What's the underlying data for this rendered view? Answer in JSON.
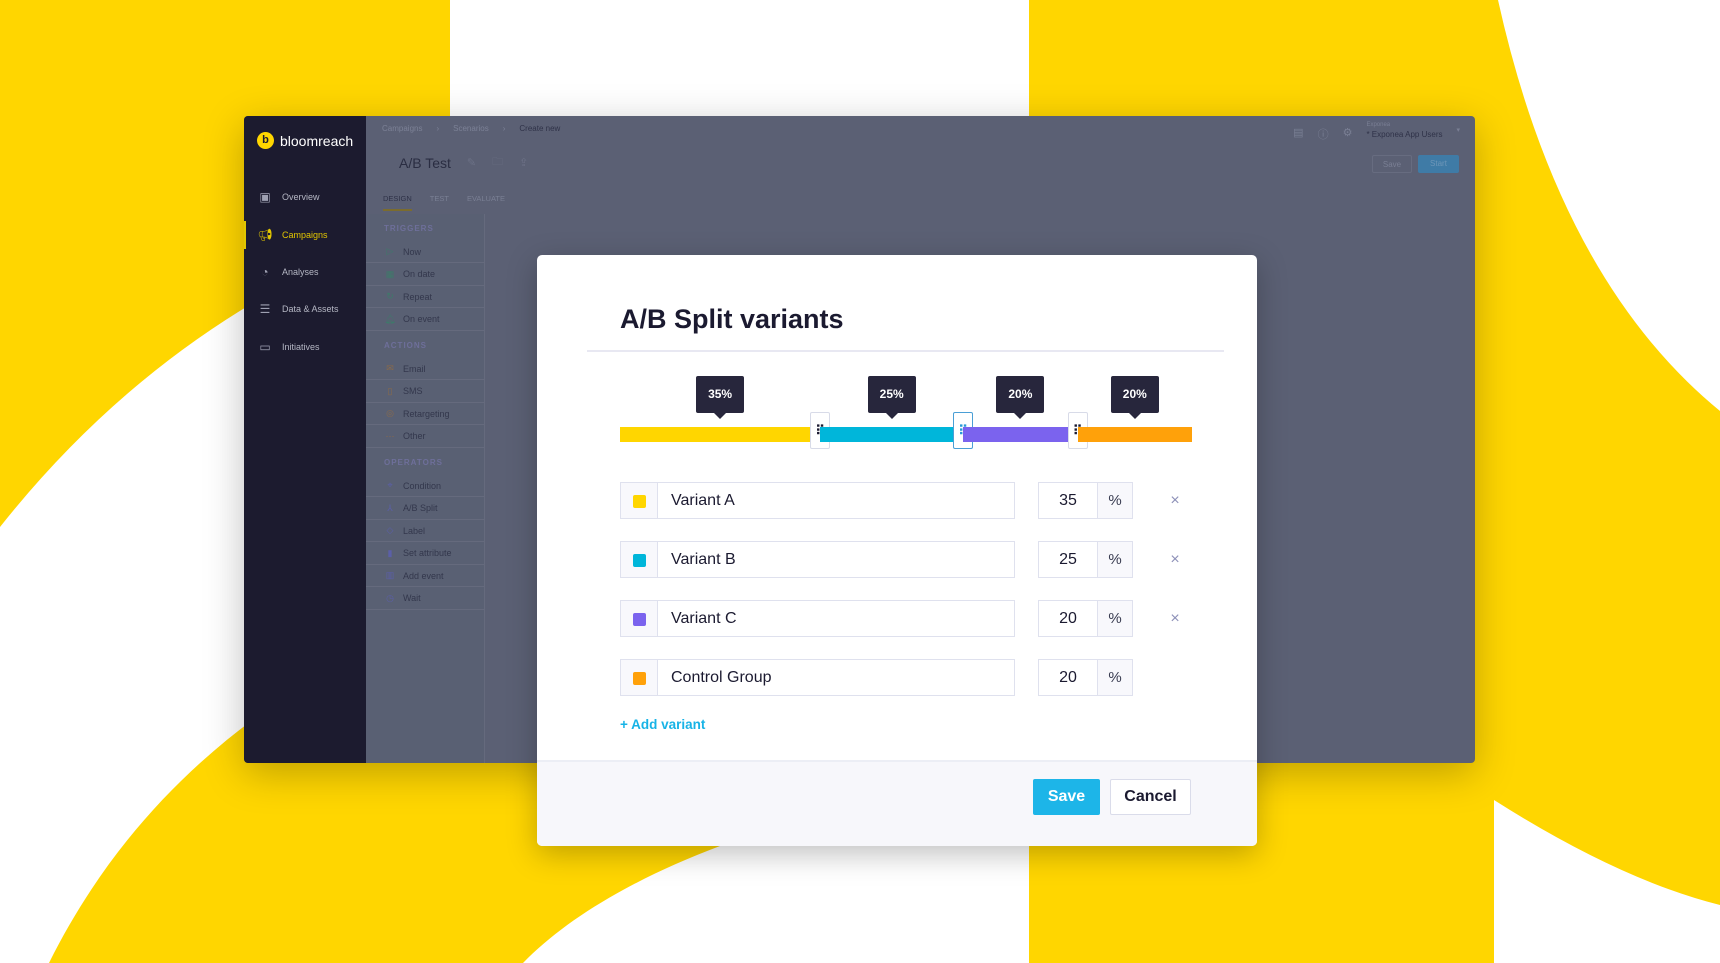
{
  "colors": {
    "brand_yellow": "#ffd600",
    "variant_a": "#ffd600",
    "variant_b": "#00b6da",
    "variant_c": "#7b63ee",
    "control": "#ffa10a",
    "save": "#1db5e8",
    "sidebar": "#1c1b2f"
  },
  "app": {
    "logo": "bloomreach",
    "sidebar": [
      {
        "label": "Overview",
        "icon": "overview-icon"
      },
      {
        "label": "Campaigns",
        "icon": "megaphone-icon",
        "active": true
      },
      {
        "label": "Analyses",
        "icon": "pie-chart-icon"
      },
      {
        "label": "Data & Assets",
        "icon": "database-icon"
      },
      {
        "label": "Initiatives",
        "icon": "folder-icon"
      }
    ],
    "breadcrumbs": [
      "Campaigns",
      "Scenarios",
      "Create new"
    ],
    "title": "A/B Test",
    "tabs": [
      "DESIGN",
      "TEST",
      "EVALUATE"
    ],
    "account": {
      "project": "Exponea",
      "name": "* Exponea App Users"
    },
    "save_label": "Save",
    "start_label": "Start",
    "panel": {
      "triggers_header": "TRIGGERS",
      "triggers": [
        "Now",
        "On date",
        "Repeat",
        "On event"
      ],
      "actions_header": "ACTIONS",
      "actions": [
        "Email",
        "SMS",
        "Retargeting",
        "Other"
      ],
      "operators_header": "OPERATORS",
      "operators": [
        "Condition",
        "A/B Split",
        "Label",
        "Set attribute",
        "Add event",
        "Wait"
      ]
    }
  },
  "modal": {
    "title": "A/B Split variants",
    "variants": [
      {
        "name": "Variant A",
        "percent": "35",
        "tooltip": "35%",
        "value": 35,
        "removable": true
      },
      {
        "name": "Variant B",
        "percent": "25",
        "tooltip": "25%",
        "value": 25,
        "removable": true
      },
      {
        "name": "Variant C",
        "percent": "20",
        "tooltip": "20%",
        "value": 20,
        "removable": true
      },
      {
        "name": "Control Group",
        "percent": "20",
        "tooltip": "20%",
        "value": 20,
        "removable": false
      }
    ],
    "percent_unit": "%",
    "remove_symbol": "×",
    "add_variant": "+ Add variant",
    "save": "Save",
    "cancel": "Cancel"
  }
}
